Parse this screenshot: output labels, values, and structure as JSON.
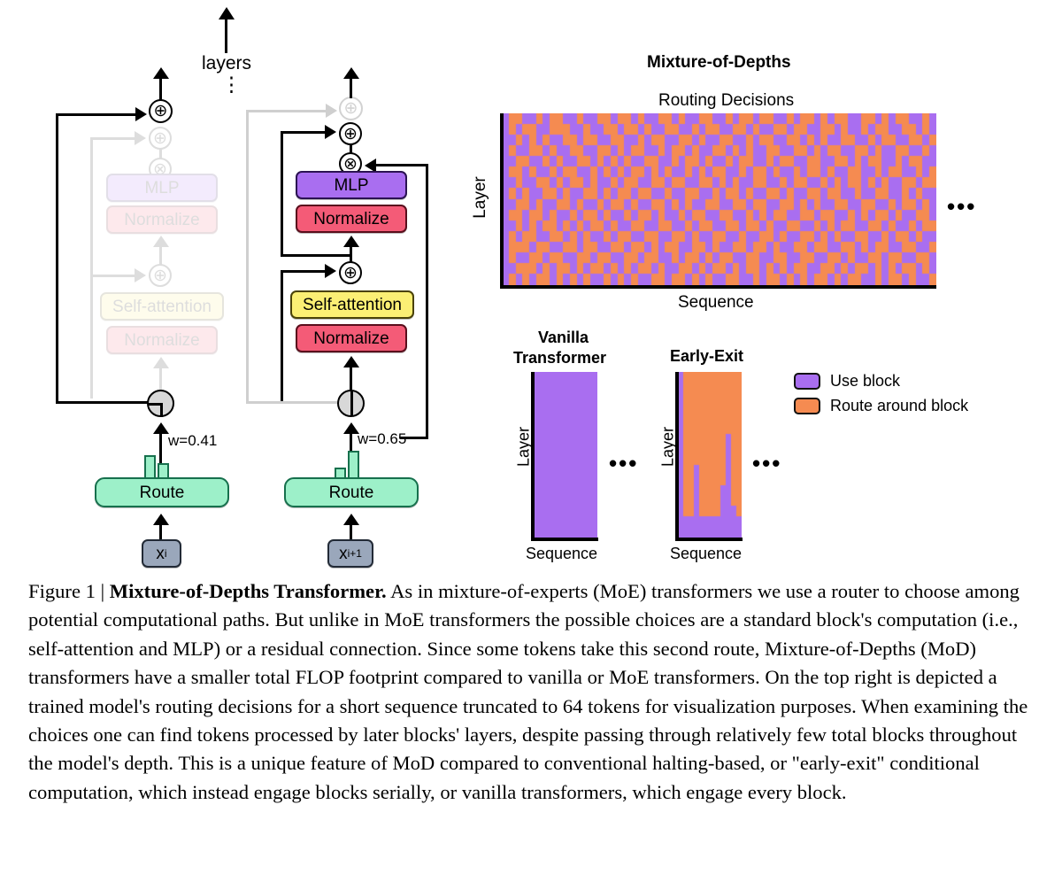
{
  "figure": {
    "caption_prefix": "Figure 1 | ",
    "caption_bold": "Mixture-of-Depths Transformer.",
    "caption_body": " As in mixture-of-experts (MoE) transformers we use a router to choose among potential computational paths. But unlike in MoE transformers the possible choices are a standard block's computation (i.e., self-attention and MLP) or a residual connection. Since some tokens take this second route, Mixture-of-Depths (MoD) transformers have a smaller total FLOP footprint compared to vanilla or MoE transformers. On the top right is depicted a trained model's routing decisions for a short sequence truncated to 64 tokens for visualization purposes. When examining the choices one can find tokens processed by later blocks' layers, despite passing through relatively few total blocks throughout the model's depth. This is a unique feature of MoD compared to conventional halting-based, or \"early-exit\" conditional computation, which instead engage blocks serially, or vanilla transformers, which engage every block."
  },
  "diagram": {
    "layers_label": "layers",
    "vertical_ellipsis": "⋮",
    "blocks": {
      "mlp": "MLP",
      "normalize": "Normalize",
      "self_attention": "Self-attention",
      "route": "Route"
    },
    "ops": {
      "add": "⊕",
      "multiply": "⊗"
    },
    "columns": [
      {
        "id": "left",
        "input_label": "x",
        "input_sub": "i",
        "weight_label": "w=0.41",
        "state": "routed-around",
        "router_hist": [
          0.95,
          0.62
        ]
      },
      {
        "id": "right",
        "input_label": "x",
        "input_sub": "i+1",
        "weight_label": "w=0.65",
        "state": "uses-block",
        "router_hist": [
          0.38,
          1.0
        ]
      }
    ]
  },
  "panels": {
    "mod_title": "Mixture-of-Depths",
    "routing_title": "Routing Decisions",
    "vanilla_title_line1": "Vanilla",
    "vanilla_title_line2": "Transformer",
    "early_exit_title": "Early-Exit",
    "axis_layer": "Layer",
    "axis_sequence": "Sequence",
    "ellipsis": "•••"
  },
  "legend": {
    "items": [
      {
        "label": "Use block",
        "color": "#a96ef0"
      },
      {
        "label": "Route around block",
        "color": "#f58b51"
      }
    ]
  },
  "colors": {
    "use_block": "#a96ef0",
    "route_around": "#f58b51",
    "mlp": "#a96ef0",
    "normalize": "#f45b77",
    "self_attention": "#fbef74",
    "route": "#9df0c9",
    "input": "#9aa7bb",
    "axis": "#000000"
  },
  "chart_data": [
    {
      "type": "heatmap",
      "title": "Routing Decisions",
      "xlabel": "Sequence",
      "ylabel": "Layer",
      "rows": 16,
      "cols": 64,
      "value_map": {
        "0": "Use block",
        "1": "Route around block"
      },
      "matrix": [
        [
          0,
          1,
          1,
          0,
          0,
          1,
          0,
          1,
          1,
          0,
          0,
          1,
          0,
          0,
          1,
          1,
          0,
          1,
          1,
          0,
          1,
          0,
          0,
          1,
          1,
          0,
          1,
          0,
          0,
          1,
          1,
          0,
          0,
          1,
          0,
          1,
          1,
          0,
          1,
          1,
          0,
          0,
          1,
          0,
          1,
          1,
          0,
          1,
          0,
          1,
          1,
          0,
          0,
          1,
          1,
          0,
          1,
          0,
          1,
          1,
          0,
          0,
          1,
          0
        ],
        [
          0,
          1,
          0,
          1,
          1,
          0,
          0,
          1,
          1,
          1,
          0,
          0,
          1,
          0,
          0,
          1,
          1,
          0,
          1,
          1,
          0,
          1,
          0,
          0,
          1,
          1,
          0,
          0,
          1,
          0,
          1,
          1,
          0,
          0,
          1,
          1,
          0,
          1,
          0,
          0,
          1,
          1,
          0,
          1,
          1,
          0,
          0,
          1,
          1,
          0,
          1,
          0,
          0,
          1,
          0,
          1,
          1,
          0,
          0,
          1,
          1,
          0,
          1,
          0
        ],
        [
          0,
          0,
          1,
          0,
          1,
          0,
          1,
          0,
          0,
          1,
          1,
          0,
          1,
          1,
          0,
          0,
          1,
          1,
          0,
          0,
          1,
          0,
          1,
          1,
          0,
          0,
          1,
          1,
          0,
          1,
          0,
          0,
          1,
          1,
          0,
          0,
          1,
          0,
          1,
          1,
          0,
          0,
          1,
          1,
          0,
          1,
          0,
          1,
          0,
          0,
          1,
          1,
          0,
          0,
          1,
          0,
          1,
          1,
          0,
          0,
          1,
          1,
          0,
          1
        ],
        [
          0,
          1,
          0,
          0,
          1,
          1,
          0,
          1,
          0,
          0,
          1,
          1,
          0,
          0,
          1,
          1,
          0,
          1,
          0,
          1,
          1,
          0,
          0,
          1,
          0,
          1,
          1,
          0,
          1,
          0,
          0,
          1,
          1,
          0,
          1,
          0,
          1,
          0,
          0,
          1,
          1,
          0,
          0,
          1,
          1,
          0,
          1,
          0,
          1,
          1,
          0,
          0,
          1,
          1,
          0,
          1,
          0,
          0,
          1,
          1,
          0,
          0,
          1,
          0
        ],
        [
          0,
          0,
          1,
          1,
          0,
          0,
          1,
          0,
          1,
          0,
          0,
          1,
          1,
          0,
          1,
          0,
          1,
          0,
          1,
          0,
          0,
          1,
          1,
          0,
          0,
          1,
          0,
          1,
          1,
          0,
          1,
          0,
          0,
          1,
          0,
          1,
          1,
          0,
          0,
          1,
          0,
          1,
          1,
          0,
          0,
          1,
          1,
          0,
          0,
          1,
          1,
          0,
          1,
          0,
          1,
          1,
          0,
          0,
          1,
          0,
          1,
          1,
          0,
          0
        ],
        [
          0,
          1,
          1,
          0,
          1,
          0,
          0,
          1,
          0,
          1,
          1,
          0,
          0,
          1,
          0,
          1,
          0,
          1,
          0,
          1,
          1,
          0,
          1,
          0,
          1,
          0,
          0,
          1,
          0,
          1,
          0,
          1,
          1,
          0,
          0,
          1,
          0,
          1,
          1,
          0,
          1,
          0,
          0,
          1,
          0,
          1,
          1,
          0,
          1,
          0,
          0,
          1,
          1,
          0,
          0,
          1,
          0,
          1,
          1,
          0,
          0,
          1,
          0,
          1
        ],
        [
          0,
          0,
          1,
          0,
          0,
          1,
          1,
          0,
          1,
          0,
          1,
          1,
          0,
          1,
          0,
          0,
          1,
          0,
          1,
          1,
          0,
          0,
          1,
          1,
          0,
          1,
          1,
          0,
          0,
          1,
          1,
          0,
          1,
          0,
          1,
          0,
          0,
          1,
          1,
          0,
          0,
          1,
          0,
          1,
          1,
          0,
          0,
          1,
          0,
          1,
          0,
          1,
          1,
          0,
          1,
          0,
          1,
          0,
          0,
          1,
          1,
          0,
          1,
          1
        ],
        [
          0,
          1,
          0,
          1,
          0,
          0,
          1,
          1,
          0,
          1,
          0,
          0,
          1,
          1,
          0,
          1,
          0,
          1,
          1,
          0,
          1,
          1,
          0,
          0,
          1,
          0,
          0,
          1,
          1,
          0,
          0,
          1,
          0,
          1,
          1,
          0,
          1,
          0,
          0,
          1,
          1,
          0,
          1,
          0,
          0,
          1,
          1,
          0,
          1,
          1,
          0,
          0,
          1,
          0,
          0,
          1,
          1,
          0,
          0,
          1,
          0,
          1,
          0,
          0
        ],
        [
          0,
          0,
          1,
          1,
          0,
          1,
          0,
          0,
          1,
          1,
          0,
          1,
          0,
          0,
          1,
          0,
          1,
          1,
          0,
          1,
          0,
          0,
          1,
          1,
          0,
          1,
          0,
          1,
          0,
          0,
          1,
          1,
          0,
          0,
          1,
          1,
          0,
          1,
          1,
          0,
          0,
          1,
          1,
          0,
          1,
          0,
          1,
          0,
          0,
          1,
          1,
          0,
          0,
          1,
          1,
          0,
          0,
          1,
          0,
          1,
          1,
          0,
          1,
          0
        ],
        [
          0,
          1,
          1,
          0,
          1,
          1,
          0,
          1,
          0,
          0,
          1,
          0,
          1,
          1,
          0,
          1,
          0,
          0,
          1,
          0,
          1,
          1,
          0,
          1,
          0,
          0,
          1,
          0,
          1,
          1,
          0,
          0,
          1,
          1,
          0,
          0,
          1,
          0,
          1,
          0,
          1,
          1,
          0,
          0,
          1,
          1,
          0,
          1,
          1,
          0,
          0,
          1,
          0,
          1,
          0,
          1,
          1,
          0,
          1,
          0,
          0,
          1,
          1,
          0
        ],
        [
          0,
          0,
          1,
          0,
          1,
          0,
          1,
          1,
          0,
          1,
          0,
          1,
          0,
          1,
          1,
          0,
          1,
          0,
          0,
          1,
          1,
          0,
          0,
          1,
          1,
          0,
          0,
          1,
          0,
          1,
          1,
          0,
          0,
          1,
          1,
          0,
          1,
          1,
          0,
          1,
          0,
          0,
          1,
          1,
          0,
          0,
          1,
          0,
          1,
          0,
          1,
          1,
          0,
          0,
          1,
          1,
          0,
          1,
          0,
          0,
          1,
          0,
          1,
          1
        ],
        [
          0,
          1,
          0,
          1,
          1,
          0,
          0,
          1,
          1,
          0,
          1,
          0,
          1,
          0,
          0,
          1,
          0,
          1,
          1,
          0,
          0,
          1,
          1,
          0,
          0,
          1,
          1,
          0,
          1,
          0,
          0,
          1,
          1,
          0,
          0,
          1,
          0,
          0,
          1,
          1,
          0,
          1,
          0,
          0,
          1,
          1,
          0,
          1,
          0,
          1,
          0,
          0,
          1,
          1,
          0,
          0,
          1,
          0,
          1,
          1,
          0,
          1,
          0,
          0
        ],
        [
          0,
          1,
          1,
          1,
          0,
          1,
          1,
          0,
          0,
          1,
          1,
          0,
          1,
          1,
          0,
          0,
          1,
          1,
          0,
          1,
          1,
          0,
          1,
          0,
          1,
          1,
          0,
          0,
          1,
          1,
          0,
          1,
          0,
          0,
          1,
          1,
          0,
          1,
          1,
          0,
          1,
          0,
          0,
          1,
          1,
          0,
          1,
          1,
          0,
          0,
          1,
          1,
          0,
          1,
          0,
          1,
          1,
          0,
          0,
          1,
          1,
          0,
          0,
          1
        ],
        [
          0,
          1,
          0,
          0,
          1,
          1,
          0,
          1,
          1,
          0,
          0,
          1,
          1,
          0,
          1,
          1,
          0,
          0,
          1,
          1,
          0,
          1,
          1,
          0,
          0,
          1,
          0,
          1,
          1,
          0,
          1,
          0,
          1,
          1,
          0,
          0,
          1,
          1,
          0,
          0,
          1,
          1,
          0,
          0,
          1,
          1,
          0,
          0,
          1,
          1,
          0,
          1,
          0,
          0,
          1,
          1,
          0,
          1,
          1,
          0,
          0,
          1,
          1,
          0
        ],
        [
          0,
          0,
          1,
          1,
          1,
          0,
          1,
          0,
          1,
          1,
          0,
          1,
          0,
          1,
          1,
          0,
          1,
          0,
          1,
          0,
          1,
          1,
          0,
          1,
          0,
          0,
          1,
          1,
          0,
          1,
          0,
          1,
          1,
          0,
          1,
          0,
          1,
          1,
          0,
          1,
          0,
          1,
          0,
          1,
          1,
          0,
          0,
          1,
          1,
          0,
          1,
          0,
          1,
          1,
          0,
          1,
          0,
          1,
          0,
          1,
          1,
          0,
          1,
          0
        ],
        [
          0,
          1,
          0,
          1,
          0,
          1,
          1,
          0,
          1,
          0,
          1,
          0,
          1,
          0,
          0,
          1,
          0,
          1,
          0,
          1,
          0,
          0,
          1,
          1,
          0,
          1,
          1,
          0,
          1,
          0,
          1,
          0,
          0,
          1,
          1,
          0,
          0,
          1,
          0,
          1,
          1,
          0,
          1,
          0,
          1,
          0,
          1,
          1,
          0,
          1,
          0,
          1,
          1,
          0,
          0,
          1,
          0,
          1,
          1,
          0,
          1,
          0,
          0,
          1
        ]
      ]
    },
    {
      "type": "heatmap",
      "title": "Vanilla Transformer",
      "xlabel": "Sequence",
      "ylabel": "Layer",
      "rows": 16,
      "cols": 12,
      "value_map": {
        "0": "Use block",
        "1": "Route around block"
      },
      "all_value": 0
    },
    {
      "type": "heatmap",
      "title": "Early-Exit",
      "xlabel": "Sequence",
      "ylabel": "Layer",
      "rows": 16,
      "cols": 12,
      "value_map": {
        "0": "Use block",
        "1": "Route around block"
      },
      "exit_depth_per_column": [
        16,
        2,
        2,
        7,
        2,
        2,
        2,
        2,
        5,
        10,
        3,
        2
      ],
      "note": "column values are the number of layers (from bottom) that use the block; remaining upper layers are routed around"
    }
  ]
}
